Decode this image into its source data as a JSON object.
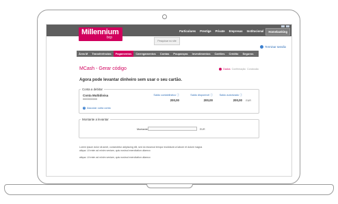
{
  "header": {
    "logo_main": "Millennium",
    "logo_sub": "bcp",
    "nav": [
      "Particulares",
      "Prestige",
      "Private",
      "Empresas",
      "Institucional",
      "Homebanking"
    ],
    "active_nav": "Homebanking",
    "search_popup": "Pesquisar no site",
    "logout": "Terminar sessão"
  },
  "menu": {
    "items": [
      "Área M",
      "Transferências",
      "Pagamentos",
      "Carregamentos",
      "Contas",
      "Poupanças",
      "Investimentos",
      "Cartões",
      "Crédito",
      "Seguros"
    ],
    "active": "Pagamentos"
  },
  "page": {
    "title": "MCash - Gerar código",
    "steps": {
      "current": "Dados",
      "next1": "Confirmação",
      "next2": "Conclusão"
    },
    "lead": "Agora pode levantar dinheiro sem usar o seu cartão."
  },
  "debit_account": {
    "section_title": "Conta a debitar",
    "account_name": "Conta Multidivisa",
    "account_number": "0000000000",
    "columns": [
      {
        "label": "Saldo contabilístico ⓘ",
        "value": "200,00"
      },
      {
        "label": "Saldo disponível ⓘ",
        "value": "200,00"
      },
      {
        "label": "Saldo autorizado ⓘ",
        "value": "200,00"
      }
    ],
    "currency": "EUR",
    "associate_link": "Associar outra conta"
  },
  "amount": {
    "section_title": "Montante a levantar",
    "label": "Montante",
    "value": "",
    "currency": "EUR"
  },
  "footer_text": {
    "p1": "Lorem ipsum dolor sit amet, consectetur adipiscing elit, sed do eiusmod tempor incididunt ut labore et dolore magna aliqua. Ut enim ad minim veniam, quis nostrud exercitation ullamco",
    "p2": "aliqua. Ut enim ad minim veniam, quis nostrud exercitation ullamco"
  },
  "colors": {
    "brand": "#d1005d",
    "link": "#2c6db8",
    "band": "#5e5e5e"
  }
}
